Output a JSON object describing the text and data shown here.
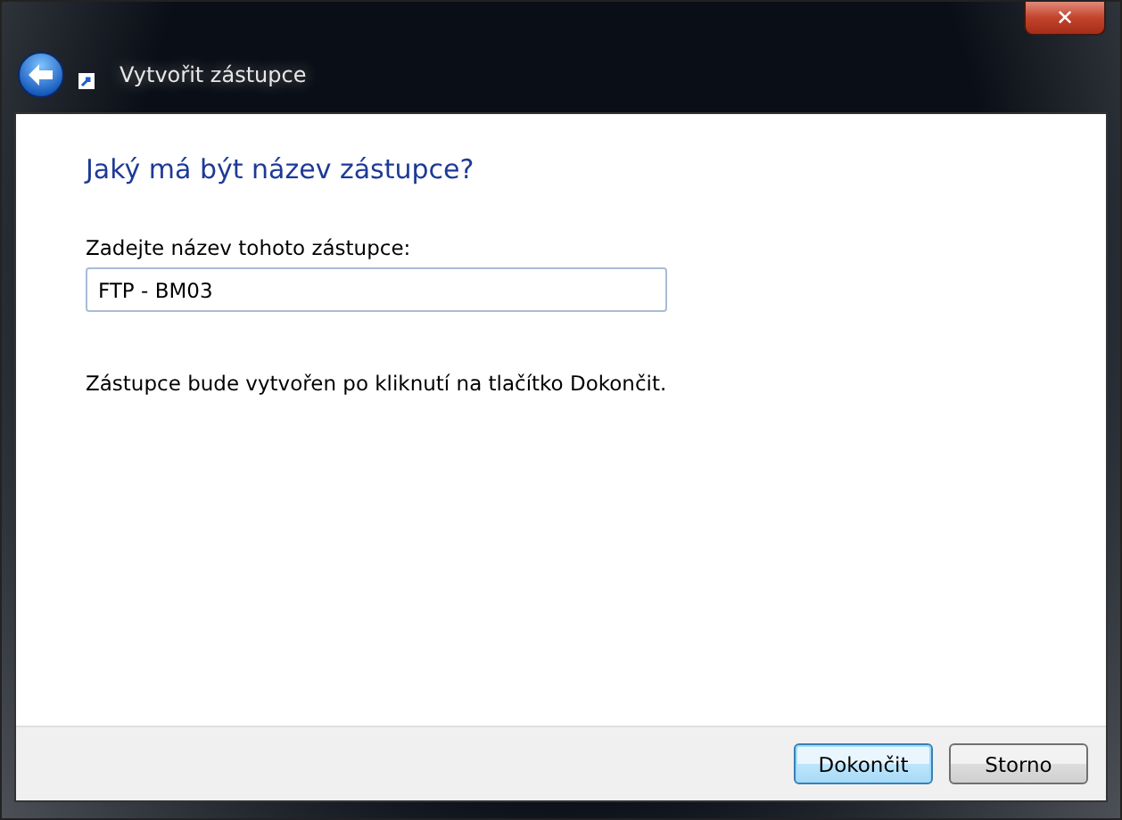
{
  "window": {
    "title": "Vytvořit zástupce",
    "close": "✕"
  },
  "heading": "Jaký má být název zástupce?",
  "name_field": {
    "label": "Zadejte název tohoto zástupce:",
    "value": "FTP - BM03"
  },
  "info": "Zástupce bude vytvořen po kliknutí na tlačítko Dokončit.",
  "buttons": [
    {
      "label": "Dokončit",
      "default": true
    },
    {
      "label": "Storno",
      "default": false
    }
  ]
}
